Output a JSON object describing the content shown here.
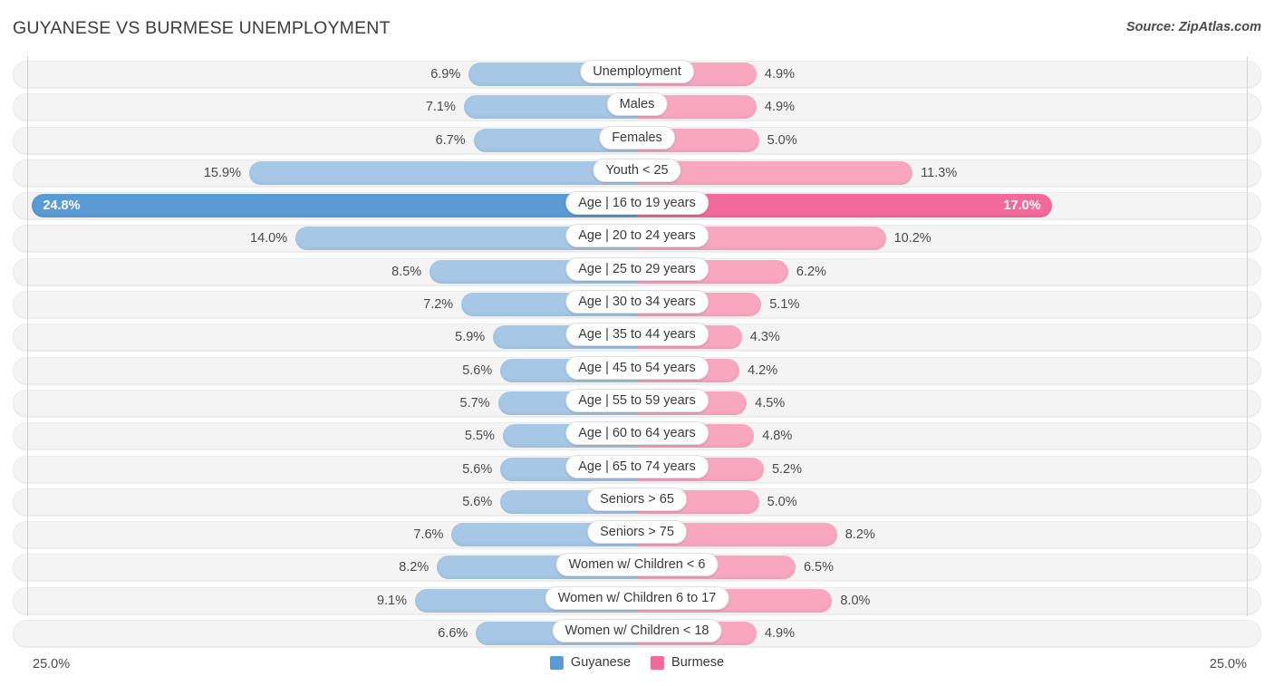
{
  "header": {
    "title": "GUYANESE VS BURMESE UNEMPLOYMENT",
    "source": "Source: ZipAtlas.com"
  },
  "footer": {
    "scale_left": "25.0%",
    "scale_right": "25.0%",
    "legend": [
      {
        "label": "Guyanese",
        "color": "#5b9bd5"
      },
      {
        "label": "Burmese",
        "color": "#f2699a"
      }
    ]
  },
  "colors": {
    "left_bar": "#a7c7e7",
    "right_bar": "#f9a7c0",
    "left_bar_highlight": "#5b9bd5",
    "right_bar_highlight": "#f2699a",
    "track": "#f4f4f4",
    "axis": "#d2d2d2"
  },
  "chart_data": {
    "type": "bar",
    "subtype": "diverging-bar",
    "title": "GUYANESE VS BURMESE UNEMPLOYMENT",
    "xlabel": "",
    "ylabel": "",
    "axis_max_percent": 25.0,
    "xlim": [
      25.0,
      25.0
    ],
    "grid": false,
    "legend_position": "bottom-center",
    "categories": [
      "Unemployment",
      "Males",
      "Females",
      "Youth < 25",
      "Age | 16 to 19 years",
      "Age | 20 to 24 years",
      "Age | 25 to 29 years",
      "Age | 30 to 34 years",
      "Age | 35 to 44 years",
      "Age | 45 to 54 years",
      "Age | 55 to 59 years",
      "Age | 60 to 64 years",
      "Age | 65 to 74 years",
      "Seniors > 65",
      "Seniors > 75",
      "Women w/ Children < 6",
      "Women w/ Children 6 to 17",
      "Women w/ Children < 18"
    ],
    "series": [
      {
        "name": "Guyanese",
        "side": "left",
        "color": "#a7c7e7",
        "values": [
          6.9,
          7.1,
          6.7,
          15.9,
          24.8,
          14.0,
          8.5,
          7.2,
          5.9,
          5.6,
          5.7,
          5.5,
          5.6,
          5.6,
          7.6,
          8.2,
          9.1,
          6.6
        ]
      },
      {
        "name": "Burmese",
        "side": "right",
        "color": "#f9a7c0",
        "values": [
          4.9,
          4.9,
          5.0,
          11.3,
          17.0,
          10.2,
          6.2,
          5.1,
          4.3,
          4.2,
          4.5,
          4.8,
          5.2,
          5.0,
          8.2,
          6.5,
          8.0,
          4.9
        ]
      }
    ],
    "rows": [
      {
        "label": "Unemployment",
        "left": "6.9%",
        "right": "4.9%",
        "left_value": 6.9,
        "right_value": 4.9,
        "highlight": false
      },
      {
        "label": "Males",
        "left": "7.1%",
        "right": "4.9%",
        "left_value": 7.1,
        "right_value": 4.9,
        "highlight": false
      },
      {
        "label": "Females",
        "left": "6.7%",
        "right": "5.0%",
        "left_value": 6.7,
        "right_value": 5.0,
        "highlight": false
      },
      {
        "label": "Youth < 25",
        "left": "15.9%",
        "right": "11.3%",
        "left_value": 15.9,
        "right_value": 11.3,
        "highlight": false
      },
      {
        "label": "Age | 16 to 19 years",
        "left": "24.8%",
        "right": "17.0%",
        "left_value": 24.8,
        "right_value": 17.0,
        "highlight": true
      },
      {
        "label": "Age | 20 to 24 years",
        "left": "14.0%",
        "right": "10.2%",
        "left_value": 14.0,
        "right_value": 10.2,
        "highlight": false
      },
      {
        "label": "Age | 25 to 29 years",
        "left": "8.5%",
        "right": "6.2%",
        "left_value": 8.5,
        "right_value": 6.2,
        "highlight": false
      },
      {
        "label": "Age | 30 to 34 years",
        "left": "7.2%",
        "right": "5.1%",
        "left_value": 7.2,
        "right_value": 5.1,
        "highlight": false
      },
      {
        "label": "Age | 35 to 44 years",
        "left": "5.9%",
        "right": "4.3%",
        "left_value": 5.9,
        "right_value": 4.3,
        "highlight": false
      },
      {
        "label": "Age | 45 to 54 years",
        "left": "5.6%",
        "right": "4.2%",
        "left_value": 5.6,
        "right_value": 4.2,
        "highlight": false
      },
      {
        "label": "Age | 55 to 59 years",
        "left": "5.7%",
        "right": "4.5%",
        "left_value": 5.7,
        "right_value": 4.5,
        "highlight": false
      },
      {
        "label": "Age | 60 to 64 years",
        "left": "5.5%",
        "right": "4.8%",
        "left_value": 5.5,
        "right_value": 4.8,
        "highlight": false
      },
      {
        "label": "Age | 65 to 74 years",
        "left": "5.6%",
        "right": "5.2%",
        "left_value": 5.6,
        "right_value": 5.2,
        "highlight": false
      },
      {
        "label": "Seniors > 65",
        "left": "5.6%",
        "right": "5.0%",
        "left_value": 5.6,
        "right_value": 5.0,
        "highlight": false
      },
      {
        "label": "Seniors > 75",
        "left": "7.6%",
        "right": "8.2%",
        "left_value": 7.6,
        "right_value": 8.2,
        "highlight": false
      },
      {
        "label": "Women w/ Children < 6",
        "left": "8.2%",
        "right": "6.5%",
        "left_value": 8.2,
        "right_value": 6.5,
        "highlight": false
      },
      {
        "label": "Women w/ Children 6 to 17",
        "left": "9.1%",
        "right": "8.0%",
        "left_value": 9.1,
        "right_value": 8.0,
        "highlight": false
      },
      {
        "label": "Women w/ Children < 18",
        "left": "6.6%",
        "right": "4.9%",
        "left_value": 6.6,
        "right_value": 4.9,
        "highlight": false
      }
    ]
  }
}
